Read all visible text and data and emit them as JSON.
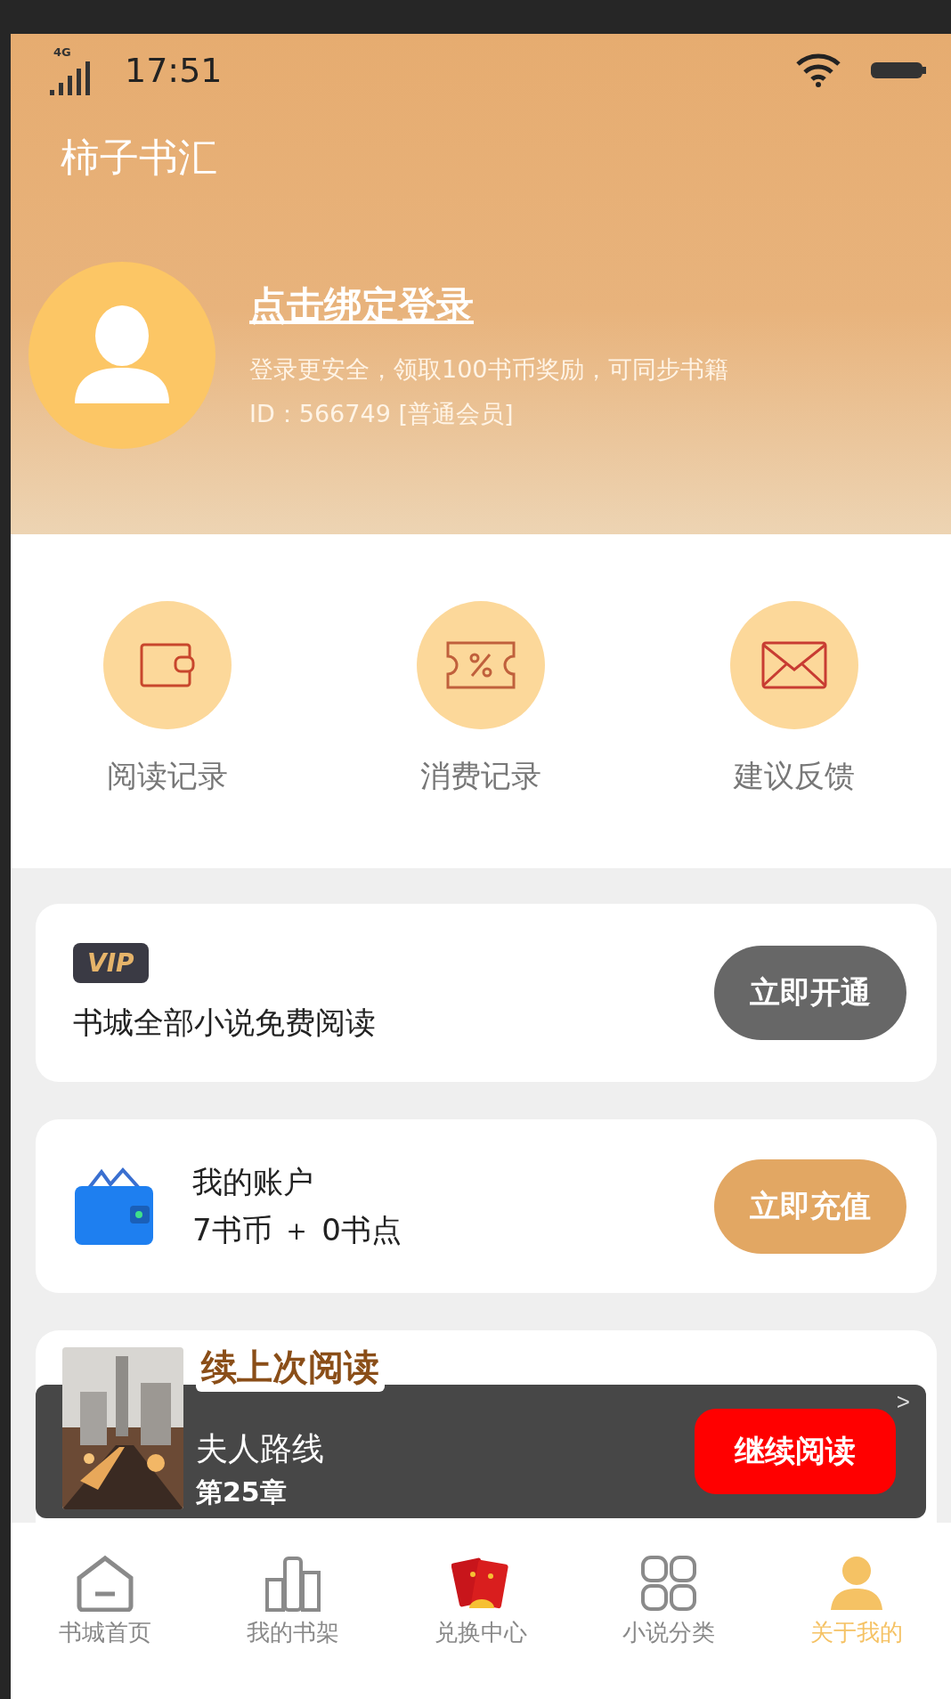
{
  "status_bar": {
    "network": "4G",
    "time": "17:51"
  },
  "app_title": "柿子书汇",
  "profile": {
    "login_link": "点击绑定登录",
    "hint": "登录更安全，领取100书币奖励，可同步书籍",
    "id_line": "ID：566749 [普通会员]"
  },
  "shortcuts": [
    {
      "kind": "wallet",
      "label": "阅读记录"
    },
    {
      "kind": "ticket",
      "label": "消费记录"
    },
    {
      "kind": "mail",
      "label": "建议反馈"
    }
  ],
  "vip_card": {
    "badge": "VIP",
    "text": "书城全部小说免费阅读",
    "button": "立即开通"
  },
  "account_card": {
    "title": "我的账户",
    "balance": "7书币 ＋ 0书点",
    "button": "立即充值"
  },
  "recent_card": {
    "heading": "续上次阅读",
    "arrow": ">"
  },
  "mini_player": {
    "book_title": "夫人路线",
    "chapter": "第25章",
    "button": "继续阅读"
  },
  "tab_bar": [
    {
      "kind": "home",
      "label": "书城首页",
      "selected": false
    },
    {
      "kind": "shelf",
      "label": "我的书架",
      "selected": false
    },
    {
      "kind": "redeem",
      "label": "兑换中心",
      "selected": false
    },
    {
      "kind": "grid",
      "label": "小说分类",
      "selected": false
    },
    {
      "kind": "person",
      "label": "关于我的",
      "selected": true
    }
  ]
}
